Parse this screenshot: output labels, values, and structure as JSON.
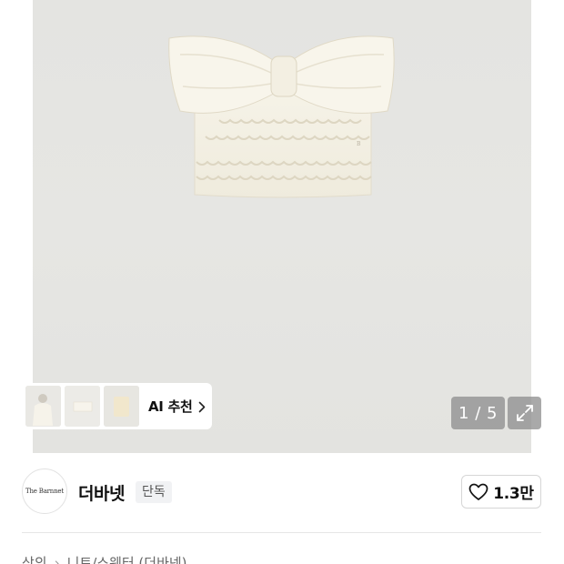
{
  "gallery": {
    "image_alt": "strapless knit bow top",
    "pager": {
      "current": "1",
      "total": "5",
      "text": "1 / 5"
    },
    "ai_recommend": {
      "label": "AI 추천"
    }
  },
  "brand": {
    "logo_text": "The Barnnet",
    "name": "더바넷",
    "badge": "단독",
    "likes": "1.3만"
  },
  "breadcrumb": {
    "items": [
      "상의",
      "니트/스웨터 (더바넷)"
    ]
  }
}
